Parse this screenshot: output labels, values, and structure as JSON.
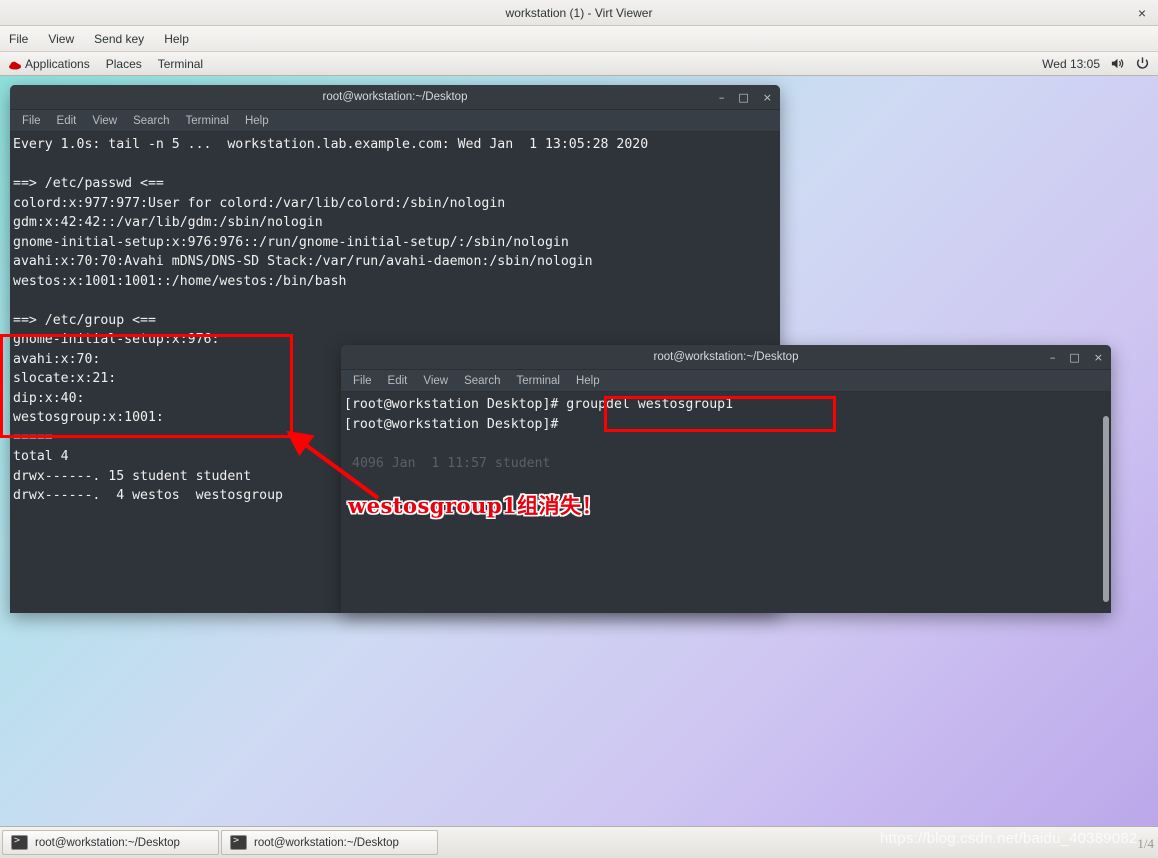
{
  "virt_viewer": {
    "title": "workstation (1) - Virt Viewer",
    "close_label": "×",
    "menu": [
      "File",
      "View",
      "Send key",
      "Help"
    ]
  },
  "gnome_panel": {
    "applications": "Applications",
    "places": "Places",
    "terminal": "Terminal",
    "clock": "Wed 13:05",
    "volume_icon": "volume-icon",
    "power_icon": "power-icon",
    "logo_icon": "redhat-logo-icon"
  },
  "terminal_one": {
    "title": "root@workstation:~/Desktop",
    "menu": [
      "File",
      "Edit",
      "View",
      "Search",
      "Terminal",
      "Help"
    ],
    "buttons": {
      "minimize": "–",
      "maximize": "□",
      "close": "×"
    },
    "lines": [
      "Every 1.0s: tail -n 5 ...  workstation.lab.example.com: Wed Jan  1 13:05:28 2020",
      "",
      "==> /etc/passwd <==",
      "colord:x:977:977:User for colord:/var/lib/colord:/sbin/nologin",
      "gdm:x:42:42::/var/lib/gdm:/sbin/nologin",
      "gnome-initial-setup:x:976:976::/run/gnome-initial-setup/:/sbin/nologin",
      "avahi:x:70:70:Avahi mDNS/DNS-SD Stack:/var/run/avahi-daemon:/sbin/nologin",
      "westos:x:1001:1001::/home/westos:/bin/bash",
      "",
      "==> /etc/group <==",
      "gnome-initial-setup:x:976:",
      "avahi:x:70:",
      "slocate:x:21:",
      "dip:x:40:",
      "westosgroup:x:1001:",
      "=====",
      "total 4",
      "drwx------. 15 student student",
      "drwx------.  4 westos  westosgroup"
    ]
  },
  "terminal_two": {
    "title": "root@workstation:~/Desktop",
    "menu": [
      "File",
      "Edit",
      "View",
      "Search",
      "Terminal",
      "Help"
    ],
    "buttons": {
      "minimize": "–",
      "maximize": "□",
      "close": "×"
    },
    "prompt": "[root@workstation Desktop]#",
    "command": "groupdel westosgroup1",
    "line1": "[root@workstation Desktop]# groupdel westosgroup1",
    "line2": "[root@workstation Desktop]#",
    "obscured_line": "4096 Jan  1 11:57 student"
  },
  "annotations": {
    "note_text": "westosgroup1组消失！",
    "highlight_color": "#ff0000",
    "note_color": "#e8000d"
  },
  "taskbar": {
    "items": [
      "root@workstation:~/Desktop",
      "root@workstation:~/Desktop"
    ]
  },
  "watermark": {
    "url": "https://blog.csdn.net/baidu_40389082",
    "page": "1/4"
  }
}
